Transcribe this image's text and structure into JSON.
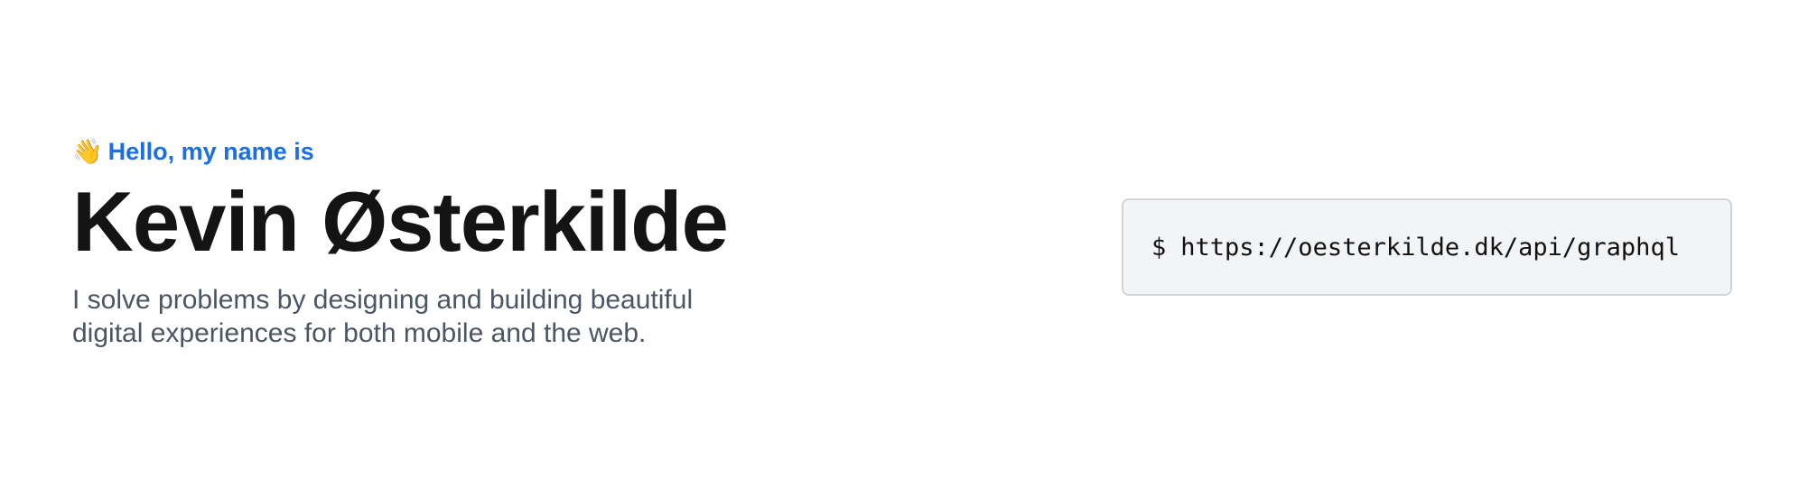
{
  "hero": {
    "greeting_icon": "waving-hand-icon",
    "greeting": "Hello, my name is",
    "name": "Kevin Østerkilde",
    "tagline": "I solve problems by designing and building beautiful digital experiences for both mobile and the web."
  },
  "command": {
    "prompt": "$",
    "url": "https://oesterkilde.dk/api/graphql"
  },
  "colors": {
    "accent": "#1a6fe8",
    "heading": "#141414",
    "body_text": "#4b5563",
    "code_bg": "#f3f4f6",
    "code_border": "#d1d5db"
  }
}
